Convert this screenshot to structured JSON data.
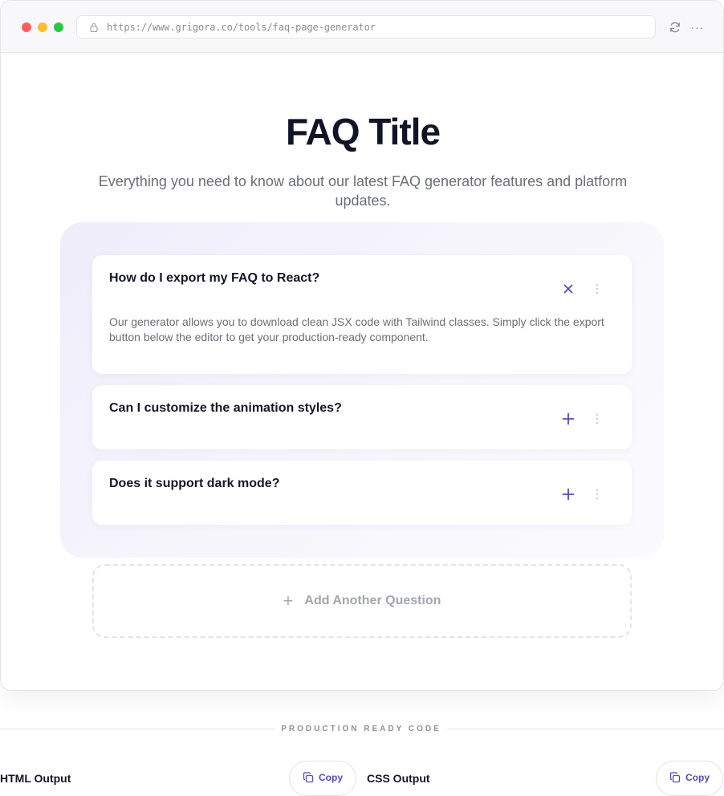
{
  "browser": {
    "url": "https://www.grigora.co/tools/faq-page-generator",
    "more_glyph": "···"
  },
  "page": {
    "title": "FAQ Title",
    "subtitle": "Everything you need to know about our latest FAQ generator features and platform updates."
  },
  "faq": {
    "items": [
      {
        "question": "How do I export my FAQ to React?",
        "answer": "Our generator allows you to download clean JSX code with Tailwind classes. Simply click the export button below the editor to get your production-ready component.",
        "expanded": true,
        "toggle_icon": "close-icon"
      },
      {
        "question": "Can I customize the animation styles?",
        "answer": "",
        "expanded": false,
        "toggle_icon": "plus-icon"
      },
      {
        "question": "Does it support dark mode?",
        "answer": "",
        "expanded": false,
        "toggle_icon": "plus-icon"
      }
    ],
    "add_label": "Add Another Question",
    "add_glyph": "+"
  },
  "output": {
    "section_label": "PRODUCTION READY CODE",
    "html_label": "HTML Output",
    "css_label": "CSS Output",
    "copy_label": "Copy"
  },
  "colors": {
    "accent": "#5b45c9",
    "title": "#111425",
    "muted": "#6b6e78"
  }
}
